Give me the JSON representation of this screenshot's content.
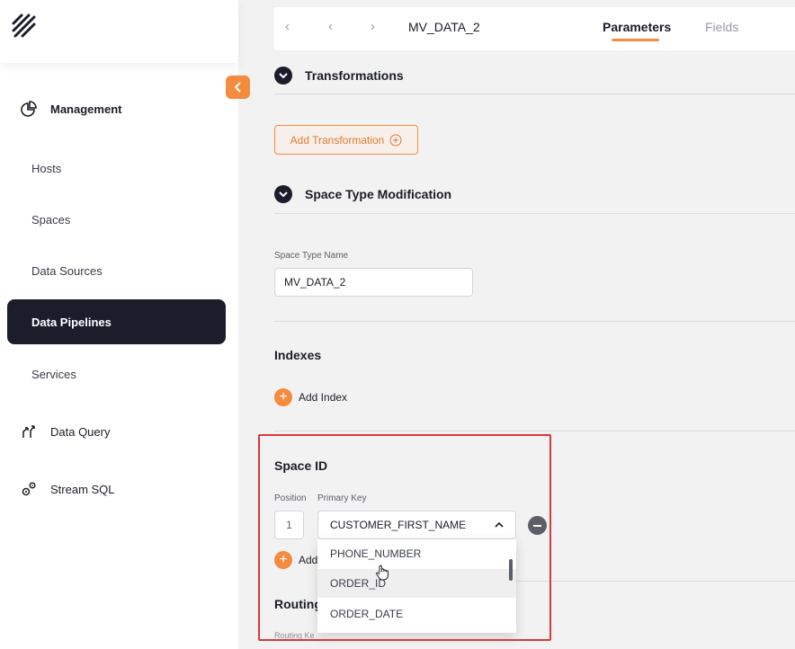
{
  "sidebar": {
    "section_management": "Management",
    "items": [
      "Hosts",
      "Spaces",
      "Data Sources"
    ],
    "active_item": "Data Pipelines",
    "services": "Services",
    "data_query": "Data Query",
    "stream_sql": "Stream SQL"
  },
  "header": {
    "title": "MV_DATA_2",
    "tab_parameters": "Parameters",
    "tab_fields": "Fields"
  },
  "transformations": {
    "title": "Transformations",
    "add_button": "Add Transformation"
  },
  "space_type": {
    "title": "Space Type Modification",
    "name_label": "Space Type Name",
    "name_value": "MV_DATA_2"
  },
  "indexes": {
    "title": "Indexes",
    "add_label": "Add Index"
  },
  "space_id": {
    "title": "Space ID",
    "position_label": "Position",
    "primary_key_label": "Primary Key",
    "position_value": "1",
    "selected_key": "CUSTOMER_FIRST_NAME",
    "add_label_partial": "Add",
    "options": [
      "PHONE_NUMBER",
      "ORDER_ID",
      "ORDER_DATE"
    ]
  },
  "routing": {
    "title_partial": "Routing",
    "key_label_partial": "Routing Ke"
  },
  "colors": {
    "accent": "#f58b3e",
    "dark": "#1b1d2b",
    "highlight": "#d93a3a"
  }
}
